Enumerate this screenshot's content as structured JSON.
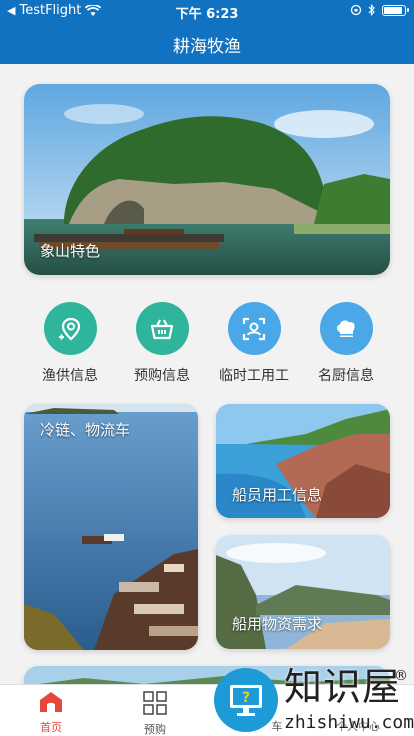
{
  "status_bar": {
    "carrier": "TestFlight",
    "time": "下午 6:23"
  },
  "header": {
    "title": "耕海牧渔"
  },
  "banner": {
    "label": "象山特色"
  },
  "quick_links": [
    {
      "label": "渔供信息",
      "icon": "location-icon"
    },
    {
      "label": "预购信息",
      "icon": "basket-icon"
    },
    {
      "label": "临时工用工",
      "icon": "face-scan-icon"
    },
    {
      "label": "名厨信息",
      "icon": "chef-hat-icon"
    }
  ],
  "tiles": {
    "cold_chain": "冷链、物流车",
    "crew": "船员用工信息",
    "supplies": "船用物资需求"
  },
  "tabbar": [
    {
      "label": "首页",
      "active": true
    },
    {
      "label": "预购"
    },
    {
      "label": "车"
    },
    {
      "label": "个人中心"
    }
  ],
  "watermark": {
    "text": "知识屋",
    "url": "zhishiwu.com"
  },
  "colors": {
    "header": "#1172c2",
    "active_tab": "#e8453c"
  }
}
